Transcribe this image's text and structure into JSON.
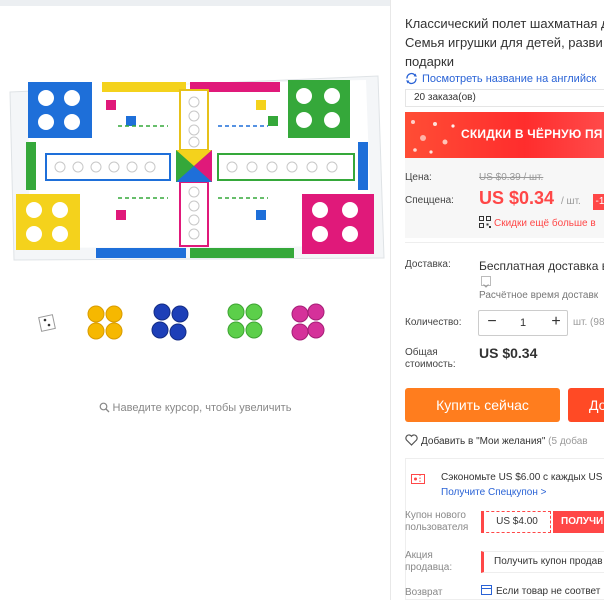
{
  "product": {
    "title_lines": [
      "Классический полет шахматная д",
      "Семья игрушки для детей, разви",
      "подарки"
    ],
    "translate_link": "Посмотреть название на английск",
    "orders": "20 заказа(ов)"
  },
  "banner": {
    "text": "СКИДКИ В ЧЁРНУЮ ПЯ"
  },
  "price": {
    "price_label": "Цена:",
    "old_price": "US $0.39 / шт.",
    "sale_label": "Спеццена:",
    "sale_price": "US $0.34",
    "unit": "/ шт.",
    "discount_badge": "-1",
    "qr_text": "Скидки ещё больше в"
  },
  "shipping": {
    "label": "Доставка:",
    "value": "Бесплатная доставка в F",
    "time": "Расчётное время доставк"
  },
  "quantity": {
    "label": "Количество:",
    "minus": "−",
    "value": "1",
    "plus": "+",
    "stock": "шт. (98"
  },
  "total": {
    "label_line1": "Общая",
    "label_line2": "стоимость:",
    "value": "US $0.34"
  },
  "actions": {
    "buy_now": "Купить сейчас",
    "add_to_cart": "До",
    "wishlist": "Добавить в \"Мои желания\"",
    "wishlist_count": "(5 добав"
  },
  "coupons": {
    "save_text": "Сэкономьте US $6.00 с каждых US",
    "save_link": "Получите Спецкупон >",
    "new_user_label_1": "Купон нового",
    "new_user_label_2": "пользователя",
    "new_user_amount": "US $4.00",
    "new_user_get": "ПОЛУЧИ",
    "seller_label_1": "Акция",
    "seller_label_2": "продавца:",
    "seller_coupon": "Получить купон продав",
    "return_label": "Возврат",
    "return_value": "Если товар не соответ"
  },
  "gallery": {
    "zoom_hint": "Наведите курсор, чтобы увеличить"
  },
  "colors": {
    "accent_red": "#ff4747",
    "buy_orange": "#ff7d1e",
    "link_blue": "#2a63d6"
  }
}
